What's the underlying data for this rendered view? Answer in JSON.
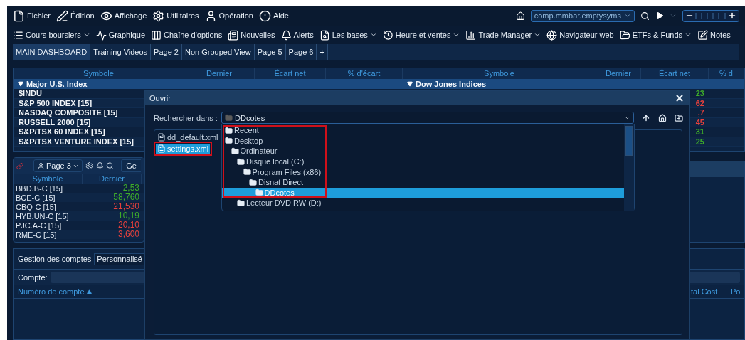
{
  "menu": [
    {
      "label": "Fichier"
    },
    {
      "label": "Édition"
    },
    {
      "label": "Affichage"
    },
    {
      "label": "Utilitaires"
    },
    {
      "label": "Opération"
    },
    {
      "label": "Aide"
    }
  ],
  "symbol_selector": {
    "value": "comp.mmbar.emptysyms"
  },
  "toolbar": [
    {
      "label": "Cours boursiers",
      "dropdown": true
    },
    {
      "label": "Graphique",
      "dropdown": false
    },
    {
      "label": "Chaîne d'options",
      "dropdown": false
    },
    {
      "label": "Nouvelles",
      "dropdown": false
    },
    {
      "label": "Alerts",
      "dropdown": false
    },
    {
      "label": "Les bases",
      "dropdown": true
    },
    {
      "label": "Heure et ventes",
      "dropdown": true
    },
    {
      "label": "Trade Manager",
      "dropdown": true
    },
    {
      "label": "Navigateur web",
      "dropdown": false
    },
    {
      "label": "ETFs & Funds",
      "dropdown": true
    },
    {
      "label": "Notes",
      "dropdown": false
    }
  ],
  "tabs": [
    {
      "label": "MAIN DASHBOARD",
      "selected": true
    },
    {
      "label": "Training Videos",
      "selected": false
    },
    {
      "label": "Page 2",
      "selected": false
    },
    {
      "label": "Non Grouped View",
      "selected": false
    },
    {
      "label": "Page 5",
      "selected": false
    },
    {
      "label": "Page 6",
      "selected": false
    },
    {
      "label": "+",
      "selected": false
    }
  ],
  "quotes_left": {
    "columns": [
      "Symbole",
      "Dernier",
      "Écart net",
      "% d'écart"
    ],
    "group": "Major U.S. Index",
    "expanded": true,
    "rows": [
      {
        "symbol": "$INDU"
      },
      {
        "symbol": "S&P 500 INDEX [15]"
      },
      {
        "symbol": "NASDAQ COMPOSITE [15]"
      },
      {
        "symbol": "RUSSELL 2000 [15]"
      },
      {
        "symbol": "S&P/TSX 60 INDEX [15]"
      },
      {
        "symbol": "S&P/TSX VENTURE INDEX [15]"
      }
    ]
  },
  "quotes_right": {
    "columns": [
      "Symbole",
      "Dernier",
      "Écart net",
      "% d"
    ],
    "group": "Dow Jones Indices",
    "expanded": true,
    "rows": [
      {
        "value": "23",
        "color": "#3fae2a"
      },
      {
        "value": "62",
        "color": "#e8413c"
      },
      {
        "value": ",7",
        "color": "#e8413c"
      },
      {
        "value": "45",
        "color": "#e8413c"
      },
      {
        "value": "31",
        "color": "#3fae2a"
      },
      {
        "value": "25",
        "color": "#3fae2a"
      }
    ]
  },
  "watchlist": {
    "page": "Page 3",
    "tab": "Ge",
    "columns": [
      "Symbole",
      "Dernier"
    ],
    "rows": [
      {
        "symbol": "BBD.B-C [15]",
        "last": "2,53",
        "color": "#3fae2a"
      },
      {
        "symbol": "BCE-C [15]",
        "last": "58,760",
        "color": "#3fae2a"
      },
      {
        "symbol": "CBQ-C [15]",
        "last": "21,530",
        "color": "#e8413c"
      },
      {
        "symbol": "HYB.UN-C [15]",
        "last": "10,19",
        "color": "#3fae2a"
      },
      {
        "symbol": "PJC.A-C [15]",
        "last": "20,10",
        "color": "#e8413c"
      },
      {
        "symbol": "RME-C [15]",
        "last": "3,600",
        "color": "#e8413c"
      }
    ]
  },
  "accounts": {
    "title": "Gestion des comptes",
    "view": "Personnalisé",
    "account_label": "Compte:",
    "columns": [
      {
        "label": "Numéro de compte",
        "sort_ascending": true
      },
      {
        "label": "tal Cost",
        "sort_ascending": false
      },
      {
        "label": "Po",
        "sort_ascending": false
      }
    ]
  },
  "dialog": {
    "title": "Ouvrir",
    "look_in_label": "Rechercher dans :",
    "look_in_value": "DDcotes",
    "files": [
      {
        "name": "dd_default.xml",
        "selected": false,
        "highlighted": false
      },
      {
        "name": "settings.xml",
        "selected": true,
        "highlighted": true
      }
    ],
    "folders": [
      {
        "name": "Recent",
        "selected": false,
        "highlighted": true
      },
      {
        "name": "Desktop",
        "selected": false,
        "highlighted": true,
        "children": [
          {
            "name": "Ordinateur",
            "selected": false,
            "highlighted": true,
            "children": [
              {
                "name": "Disque local (C:)",
                "selected": false,
                "highlighted": true,
                "children": [
                  {
                    "name": "Program Files (x86)",
                    "selected": false,
                    "highlighted": true,
                    "children": [
                      {
                        "name": "Disnat Direct",
                        "selected": false,
                        "highlighted": true,
                        "children": [
                          {
                            "name": "DDcotes",
                            "selected": true,
                            "highlighted": true
                          }
                        ]
                      }
                    ]
                  }
                ]
              },
              {
                "name": "Lecteur DVD RW (D:)",
                "selected": false,
                "highlighted": false
              }
            ]
          }
        ]
      }
    ]
  }
}
